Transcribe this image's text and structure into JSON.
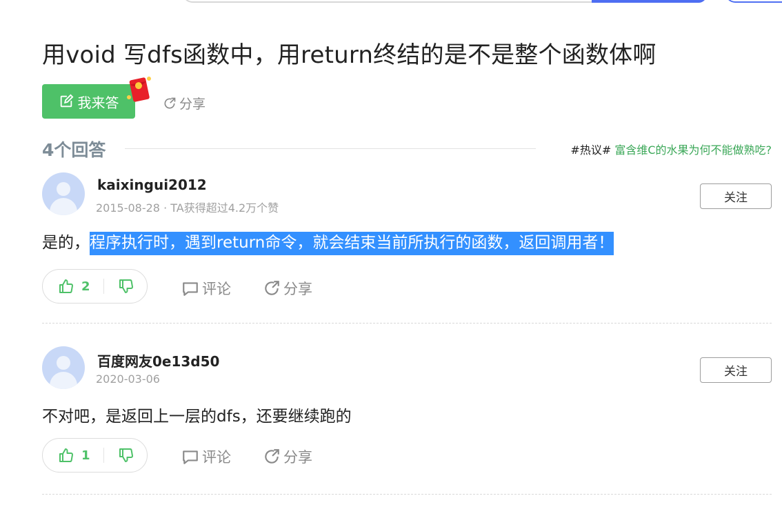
{
  "question": {
    "title": "用void 写dfs函数中，用return终结的是不是整个函数体啊",
    "answer_button_label": "我来答",
    "share_label": "分享"
  },
  "answers_header": {
    "count_label": "4个回答",
    "hot_tag": "#热议#",
    "hot_text": "富含维C的水果为何不能做熟吃?"
  },
  "answers": [
    {
      "username": "kaixingui2012",
      "meta": "2015-08-28 · TA获得超过4.2万个赞",
      "follow_label": "关注",
      "text_plain": "是的，",
      "text_highlight": "程序执行时，遇到return命令，就会结束当前所执行的函数，返回调用者！",
      "upvotes": "2",
      "comment_label": "评论",
      "share_label": "分享"
    },
    {
      "username": "百度网友0e13d50",
      "meta": "2020-03-06",
      "follow_label": "关注",
      "text_plain": "不对吧，是返回上一层的dfs，还要继续跑的",
      "text_highlight": "",
      "upvotes": "1",
      "comment_label": "评论",
      "share_label": "分享"
    }
  ],
  "colors": {
    "accent_green": "#4ec168",
    "selection_blue": "#3390ff",
    "search_blue": "#4e6ef2",
    "muted_gray": "#8a8a8a"
  },
  "icons": [
    "edit-icon",
    "red-packet-icon",
    "share-icon",
    "thumbs-up-icon",
    "thumbs-down-icon",
    "comment-icon",
    "avatar-icon"
  ]
}
